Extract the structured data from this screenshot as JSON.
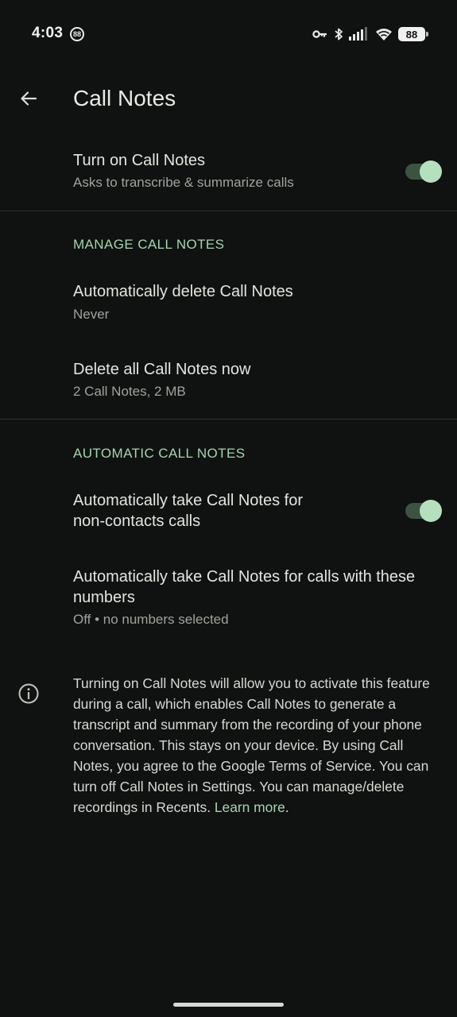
{
  "status_bar": {
    "time": "4:03",
    "notification_badge": "88",
    "battery_level": "88",
    "icons": [
      "key-icon",
      "bluetooth-icon",
      "signal-icon",
      "wifi-icon",
      "battery-icon"
    ]
  },
  "app_bar": {
    "back_icon": "arrow-back-icon",
    "title": "Call Notes"
  },
  "settings": {
    "turn_on": {
      "title": "Turn on Call Notes",
      "summary": "Asks to transcribe & summarize calls",
      "enabled": true
    },
    "manage_section": {
      "header": "MANAGE CALL NOTES",
      "auto_delete": {
        "title": "Automatically delete Call Notes",
        "summary": "Never"
      },
      "delete_all": {
        "title": "Delete all Call Notes now",
        "summary": "2 Call Notes, 2 MB"
      }
    },
    "automatic_section": {
      "header": "AUTOMATIC CALL NOTES",
      "non_contacts": {
        "title_line1": "Automatically take Call Notes for",
        "title_line2": "non-contacts calls",
        "enabled": true
      },
      "these_numbers": {
        "title_line1": "Automatically take Call Notes for calls with these",
        "title_line2": "numbers",
        "summary": "Off • no numbers selected"
      }
    }
  },
  "info": {
    "icon": "info-icon",
    "text": "Turning on Call Notes will allow you to activate this feature during a call, which enables Call Notes to generate a transcript and summary from the recording of your phone conversation. This stays on your device. By using Call Notes, you agree to the Google Terms of Service. You can turn off Call Notes in Settings. You can manage/delete recordings in Recents. ",
    "link_label": "Learn more",
    "link_suffix": "."
  },
  "colors": {
    "background": "#0f1210",
    "accent": "#a6d3b0",
    "toggle_thumb": "#b4e0be",
    "toggle_track": "#3d5342",
    "primary_text": "#e3e5e0",
    "secondary_text": "#9ea39c"
  }
}
